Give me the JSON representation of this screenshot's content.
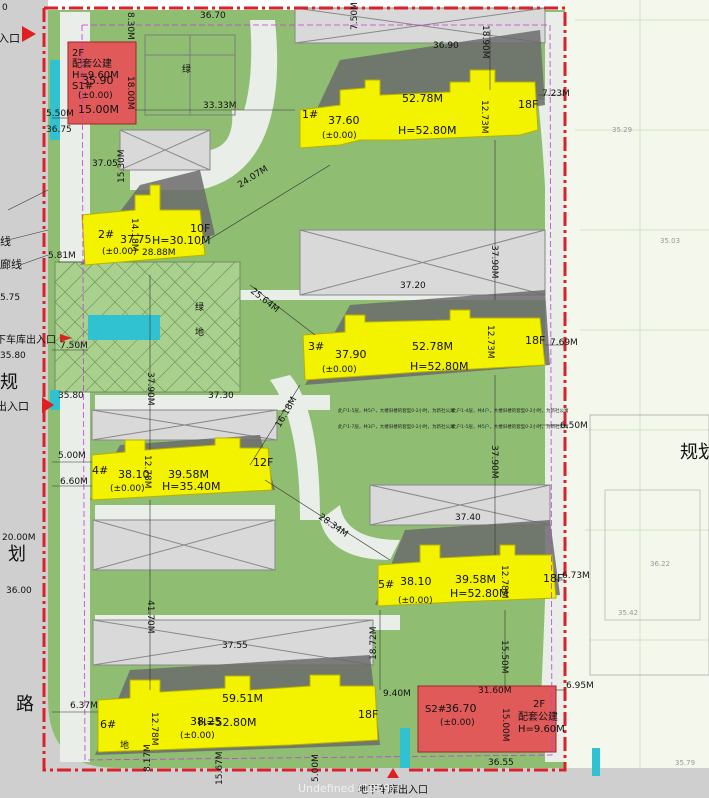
{
  "road_labels": {
    "entrance_top": "入口",
    "line1": "线",
    "line2": "廊线",
    "garage_exit": "下车库出入口",
    "plan_char": "规",
    "exit2": "出入口",
    "hua": "划",
    "lu": "路",
    "right_plan": "规划",
    "bottom_garage_exit": "地下车库出入口",
    "bottom_text": "Undefined (1959)"
  },
  "edge_numbers": {
    "top_left": "0",
    "n1": "5.50M",
    "n2": "36.75",
    "n3": "5.81M",
    "n4": "5.75",
    "n5": "35.80",
    "n6": "7.50M",
    "n7": "35.80",
    "n8": "5.00M",
    "n9": "6.60M",
    "n10": "20.00M",
    "n11": "36.00",
    "n12": "6.37M",
    "n13": "8.17M",
    "n14": "15.67M",
    "n15": "5.00M",
    "n16": "9.40M",
    "n17": "6.95M",
    "n18": "36.55",
    "n19": "7.23M",
    "n20": "7.69M",
    "n21": "6.50M",
    "n22": "6.73M",
    "n23": "35.29",
    "n24": "35.03",
    "n25": "36.22",
    "n26": "35.42",
    "n27": "35.79"
  },
  "buildings": [
    {
      "id": "b1",
      "num": "1#",
      "elev": "37.60",
      "zero": "(±0.00)",
      "height": "H=52.80M",
      "width": "52.78M",
      "floors": "18F",
      "depth": "12.73M",
      "top_elev": "36.90",
      "top_width": "18.90M"
    },
    {
      "id": "b2",
      "num": "2#",
      "elev": "37.75",
      "zero": "(±0.00)",
      "height": "H=30.10M",
      "width": "28.88M",
      "floors": "10F",
      "depth": "14.18M",
      "top_elev": "37.05"
    },
    {
      "id": "b3",
      "num": "3#",
      "elev": "37.90",
      "zero": "(±0.00)",
      "height": "H=52.80M",
      "width": "52.78M",
      "floors": "18F",
      "depth": "12.73M",
      "top_elev": "37.20"
    },
    {
      "id": "b4",
      "num": "4#",
      "elev": "38.10",
      "zero": "(±0.00)",
      "height": "H=35.40M",
      "width": "39.58M",
      "floors": "12F",
      "depth": "12.78M",
      "top_elev": "37.30"
    },
    {
      "id": "b5",
      "num": "5#",
      "elev": "38.10",
      "zero": "(±0.00)",
      "height": "H=52.80M",
      "width": "39.58M",
      "floors": "18F",
      "depth": "12.78M",
      "top_elev": "37.40"
    },
    {
      "id": "b6",
      "num": "6#",
      "elev": "38.25",
      "zero": "(±0.00)",
      "height": "H=52.80M",
      "width": "59.51M",
      "floors": "18F",
      "depth": "12.78M",
      "top_elev": "37.55"
    }
  ],
  "public_buildings": [
    {
      "id": "s1",
      "floors": "2F",
      "name": "配套公建",
      "height": "H=9.60M",
      "code": "S1#",
      "elev": "35.90",
      "zero": "(±0.00)",
      "width": "15.00M",
      "depth": "18.00M",
      "side": "8.30M"
    },
    {
      "id": "s2",
      "floors": "2F",
      "name": "配套公建",
      "height": "H=9.60M",
      "code": "S2#",
      "elev": "36.70",
      "zero": "(±0.00)",
      "width": "31.60M",
      "depth": "15.00M"
    }
  ],
  "dimensions": {
    "d_top": "36.70",
    "d_top2": "7.50M",
    "d1": "33.33M",
    "d2": "24.07M",
    "d3": "15.30M",
    "d4": "25.64M",
    "d5": "37.90M",
    "d6": "16.18M",
    "d7": "37.90M",
    "d8": "28.34M",
    "d9": "41.70M",
    "d10": "18.72M",
    "d11": "15.50M",
    "d12": "37.90M",
    "d13": "37.40"
  },
  "notes": {
    "n1": "此户1-5层，共5户，大楼旧楼的套型0-2小时，为新社公寓",
    "n2": "此户1-4层，共4户，大楼旧楼的套型0-2小时，为新社公寓",
    "n3": "此户1-7层，共3户，大楼旧楼的套型0-2小时，为新社公寓",
    "n4": "此户1-5层，共5户，大楼旧楼的套型0-2小时，为新社公寓"
  },
  "green_marks": {
    "g1": "绿",
    "g2": "绿",
    "g3": "地",
    "g4": "地"
  },
  "colors": {
    "road": "#cfcfcf",
    "site": "#8fbe72",
    "building": "#f3f300",
    "public": "#e05a5a",
    "redline": "#d8222a",
    "water": "#31c2d2"
  }
}
